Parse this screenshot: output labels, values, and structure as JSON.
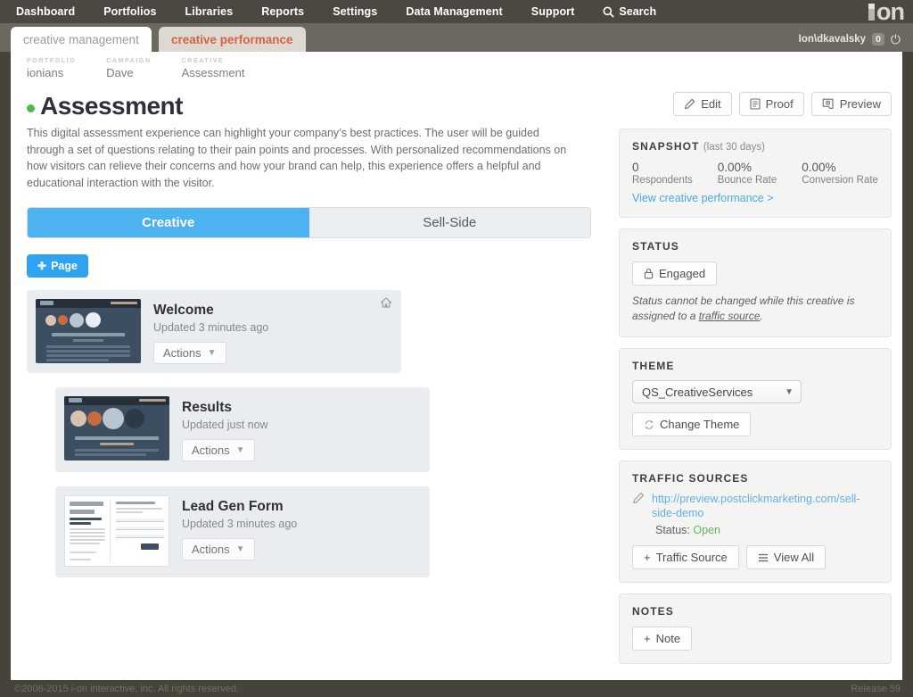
{
  "topnav": {
    "items": [
      "Dashboard",
      "Portfolios",
      "Libraries",
      "Reports",
      "Settings",
      "Data Management",
      "Support"
    ],
    "search_label": "Search",
    "search_icon": "search-icon",
    "logo": "ion"
  },
  "tabs": {
    "management": "creative management",
    "performance": "creative performance"
  },
  "user": {
    "name": "Ion\\dkavalsky",
    "badge": "0",
    "power_icon": "power-icon"
  },
  "breadcrumb": [
    {
      "type": "PORTFOLIO",
      "value": "ionians"
    },
    {
      "type": "CAMPAIGN",
      "value": "Dave"
    },
    {
      "type": "CREATIVE",
      "value": "Assessment"
    }
  ],
  "creative": {
    "status_dot_color": "#4eb94e",
    "title": "Assessment",
    "description": "This digital assessment experience can highlight your company’s best practices. The user will be guided through a set of questions relating to their pain points and processes. With personalized recommendations on how visitors can relieve their concerns and how your brand can help, this experience offers a helpful and educational interaction with the visitor."
  },
  "segmented": {
    "active": "Creative",
    "inactive": "Sell-Side",
    "active_color": "#4cb3f0"
  },
  "add_page_button": {
    "label": "Page",
    "icon": "plus-icon",
    "color": "#2ea3f2"
  },
  "pages": [
    {
      "name": "Welcome",
      "updated": "Updated 3 minutes ago",
      "actions_label": "Actions",
      "level": 0,
      "home_icon": "home-icon",
      "thumb": "dark"
    },
    {
      "name": "Results",
      "updated": "Updated just now",
      "actions_label": "Actions",
      "level": 1,
      "thumb": "dark"
    },
    {
      "name": "Lead Gen Form",
      "updated": "Updated 3 minutes ago",
      "actions_label": "Actions",
      "level": 2,
      "thumb": "light"
    }
  ],
  "toolbar": {
    "edit": "Edit",
    "proof": "Proof",
    "preview": "Preview",
    "edit_icon": "pencil-icon",
    "proof_icon": "document-icon",
    "preview_icon": "eye-icon"
  },
  "snapshot": {
    "title": "SNAPSHOT",
    "subtitle": "(last 30 days)",
    "stats": [
      {
        "value": "0",
        "label": "Respondents"
      },
      {
        "value": "0.00%",
        "label": "Bounce Rate"
      },
      {
        "value": "0.00%",
        "label": "Conversion Rate"
      }
    ],
    "link": "View creative performance >"
  },
  "status": {
    "title": "STATUS",
    "value": "Engaged",
    "lock_icon": "lock-icon",
    "note_prefix": "Status cannot be changed while this creative is assigned to a ",
    "note_link": "traffic source",
    "note_suffix": "."
  },
  "theme": {
    "title": "THEME",
    "selected": "QS_CreativeServices",
    "chevron_icon": "chevron-down-icon",
    "change_label": "Change Theme",
    "change_icon": "refresh-icon"
  },
  "traffic_sources": {
    "title": "TRAFFIC SOURCES",
    "edit_icon": "pencil-icon",
    "url": "http://preview.postclickmarketing.com/sell-side-demo",
    "status_label": "Status:",
    "status_value": "Open",
    "add_label": "Traffic Source",
    "add_icon": "plus-icon",
    "view_all_label": "View All",
    "view_all_icon": "list-icon"
  },
  "notes": {
    "title": "NOTES",
    "add_label": "Note",
    "add_icon": "plus-icon"
  },
  "footer": {
    "copyright": "©2006-2015 i-on interactive, inc. All rights reserved.",
    "release": "Release 59"
  }
}
